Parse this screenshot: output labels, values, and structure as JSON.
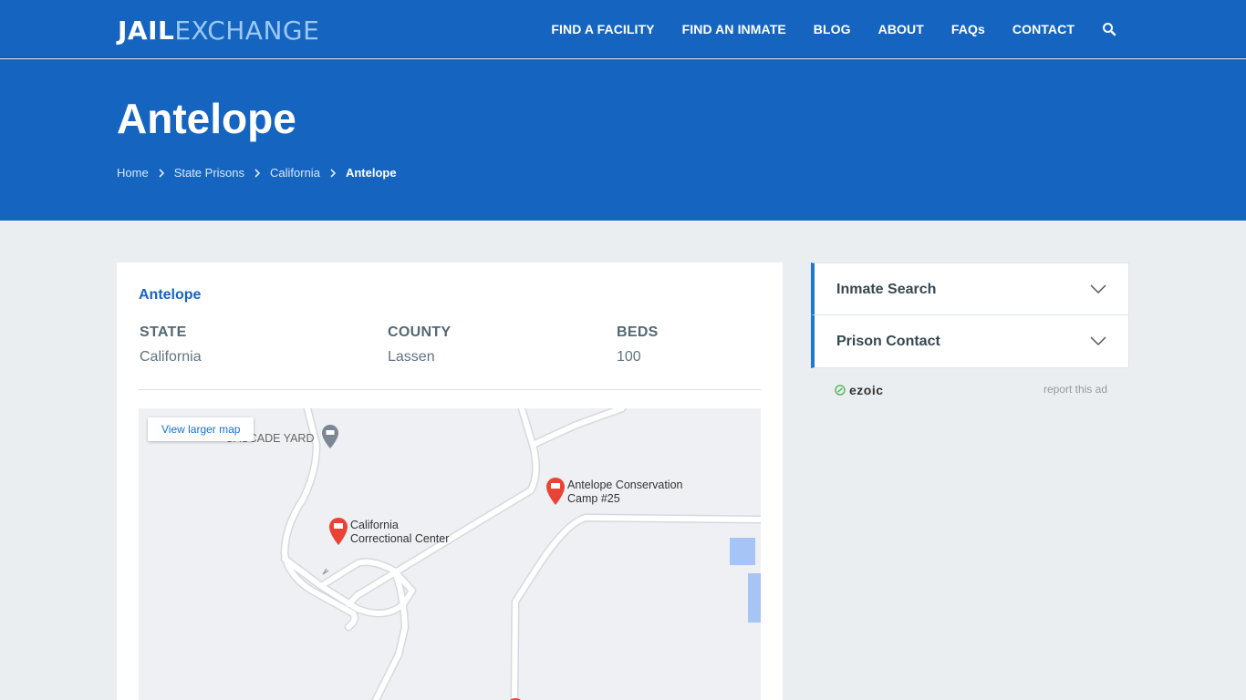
{
  "brand": {
    "part1": "JAIL",
    "part2": "EXCHANGE"
  },
  "nav": {
    "items": [
      "FIND A FACILITY",
      "FIND AN INMATE",
      "BLOG",
      "ABOUT",
      "FAQs",
      "CONTACT"
    ]
  },
  "hero": {
    "title": "Antelope"
  },
  "breadcrumb": {
    "items": [
      "Home",
      "State Prisons",
      "California"
    ],
    "current": "Antelope"
  },
  "facility": {
    "name": "Antelope",
    "facts": [
      {
        "label": "STATE",
        "value": "California"
      },
      {
        "label": "COUNTY",
        "value": "Lassen"
      },
      {
        "label": "BEDS",
        "value": "100"
      }
    ]
  },
  "map": {
    "button": "View larger map",
    "labels": {
      "cascade": "CASCADE YARD",
      "ccc_1": "California",
      "ccc_2": "Correctional Center",
      "camp_1": "Antelope Conservation",
      "camp_2": "Camp #25"
    }
  },
  "sidebar": {
    "accordions": [
      "Inmate Search",
      "Prison Contact"
    ]
  },
  "ad": {
    "brand": "ezoic",
    "report": "report this ad"
  },
  "colors": {
    "primary": "#1565c0",
    "accent_light": "#9cc8f5",
    "link": "#1565c0"
  }
}
